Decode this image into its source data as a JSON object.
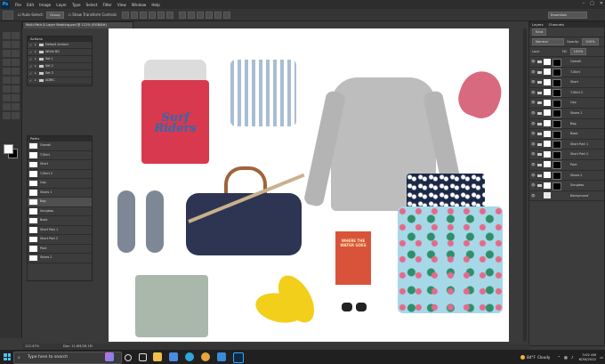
{
  "app": {
    "logo": "Ps"
  },
  "menu": [
    "File",
    "Edit",
    "Image",
    "Layer",
    "Type",
    "Select",
    "Filter",
    "View",
    "Window",
    "Help"
  ],
  "window_controls": [
    "–",
    "□",
    "✕"
  ],
  "options": {
    "auto_select_label": "Auto-Select:",
    "auto_select_value": "Group",
    "transform_label": "Show Transform Controls",
    "workspace": "Essentials"
  },
  "document": {
    "tab_title": "Multi-Path & Layer Masking.psd @ 112% (RGB/8#)",
    "zoom": "112.47%",
    "doc_info": "Doc: 11.6M/26.1M"
  },
  "actions_panel": {
    "title": "Actions",
    "items": [
      "Default Actions",
      "White BG",
      "Set 1",
      "Set 2",
      "Set 3",
      "ADRIC"
    ]
  },
  "paths_panel": {
    "title": "Paths",
    "items": [
      "Overall",
      "T-Shirt",
      "Short",
      "T-Shirt 2",
      "Cap",
      "Shoes 1",
      "Bag",
      "Sunglass",
      "Book",
      "Short Part 1",
      "Short Part 2",
      "Pant",
      "Shoes 2"
    ]
  },
  "layers_panel": {
    "tabs": [
      "Layers",
      "Channels"
    ],
    "filter": "Kind",
    "mode": "Normal",
    "opacity_label": "Opacity:",
    "opacity_value": "100%",
    "lock_label": "Lock:",
    "fill_label": "Fill:",
    "fill_value": "100%",
    "items": [
      "Overall",
      "T-Shirt",
      "Short",
      "T-Shirt 2",
      "Cap",
      "Shoes 1",
      "Bag",
      "Book",
      "Short Part 1",
      "Short Part 2",
      "Pant",
      "Shoes 2",
      "Sunglass",
      "Background"
    ]
  },
  "taskbar": {
    "search_placeholder": "Type here to search",
    "weather_temp": "84°F",
    "weather_text": "Cloudy",
    "time": "3:02 AM",
    "date": "6/30/2022"
  },
  "canvas": {
    "book_title": "WHERE THE WATER GOES",
    "shirt_text": "Surf Riders"
  }
}
